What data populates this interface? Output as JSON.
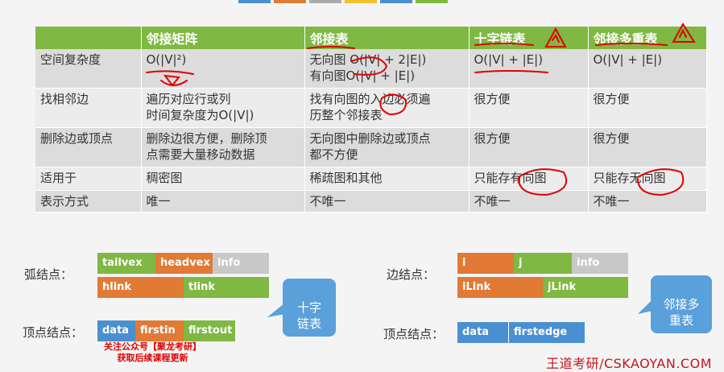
{
  "colors": {
    "green": "#7fb842",
    "orange": "#e07a35",
    "gray": "#c8c8c8",
    "blue": "#4a90d0",
    "annotation_red": "#e00000"
  },
  "table": {
    "headers": [
      "",
      "邻接矩阵",
      "邻接表",
      "十字链表",
      "邻接多重表"
    ],
    "rows": [
      {
        "label": "空间复杂度",
        "cells": [
          "O(|V|²)",
          "无向图 O(|V| + 2|E|)\n有向图O(|V| + |E|)",
          "O(|V| + |E|)",
          "O(|V| + |E|)"
        ]
      },
      {
        "label": "找相邻边",
        "cells": [
          "遍历对应行或列\n时间复杂度为O(|V|)",
          "找有向图的入边必须遍\n历整个邻接表",
          "很方便",
          "很方便"
        ]
      },
      {
        "label": "删除边或顶点",
        "cells": [
          "删除边很方便，删除顶\n点需要大量移动数据",
          "无向图中删除边或顶点\n都不方便",
          "很方便",
          "很方便"
        ]
      },
      {
        "label": "适用于",
        "cells": [
          "稠密图",
          "稀疏图和其他",
          "只能存有向图",
          "只能存无向图"
        ]
      },
      {
        "label": "表示方式",
        "cells": [
          "唯一",
          "不唯一",
          "不唯一",
          "不唯一"
        ]
      }
    ]
  },
  "cross_list": {
    "arc_label": "弧结点：",
    "arc_fields": [
      "tailvex",
      "headvex",
      "info",
      "hlink",
      "tlink"
    ],
    "vertex_label": "顶点结点：",
    "vertex_fields": [
      "data",
      "firstin",
      "firstout"
    ],
    "callout": "十字\n链表"
  },
  "multi_list": {
    "edge_label": "边结点：",
    "edge_fields": [
      "i",
      "j",
      "info",
      "iLink",
      "jLink"
    ],
    "vertex_label": "顶点结点：",
    "vertex_fields": [
      "data",
      "firstedge"
    ],
    "callout": "邻接多\n重表"
  },
  "promo": "关注公众号【聚龙考研】\n获取后续课程更新",
  "footer": "王道考研/CSKAOYAN.COM"
}
